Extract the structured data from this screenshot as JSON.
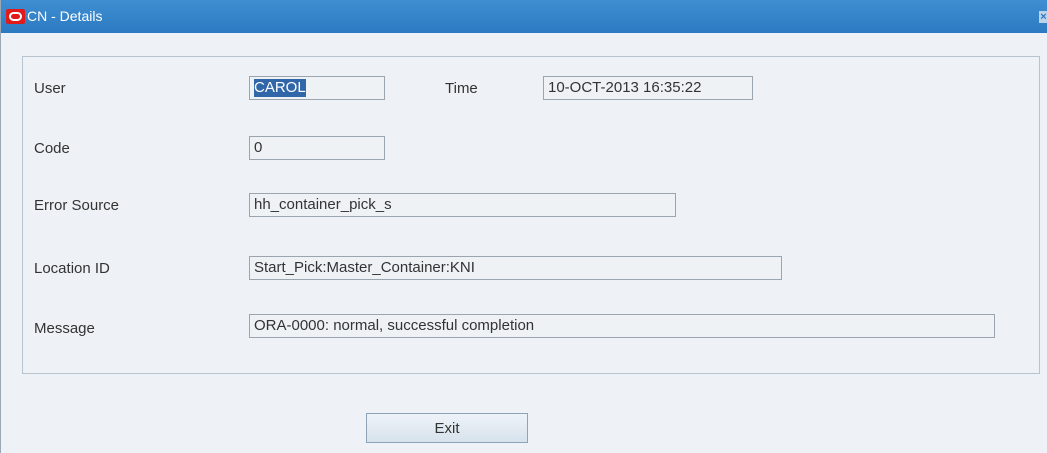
{
  "window": {
    "title": "CN - Details",
    "close_glyph": "×"
  },
  "form": {
    "user": {
      "label": "User",
      "value": "CAROL"
    },
    "time": {
      "label": "Time",
      "value": "10-OCT-2013 16:35:22"
    },
    "code": {
      "label": "Code",
      "value": "0"
    },
    "error_source": {
      "label": "Error Source",
      "value": "hh_container_pick_s"
    },
    "location_id": {
      "label": "Location ID",
      "value": "Start_Pick:Master_Container:KNI"
    },
    "message": {
      "label": "Message",
      "value": "ORA-0000: normal, successful completion"
    }
  },
  "buttons": {
    "exit_label": "Exit"
  },
  "colors": {
    "titlebar": "#2c7ac1",
    "oracle_logo": "#e01b1b",
    "selection": "#3167a8"
  },
  "icons": [
    "oracle-logo-icon",
    "close-icon"
  ]
}
